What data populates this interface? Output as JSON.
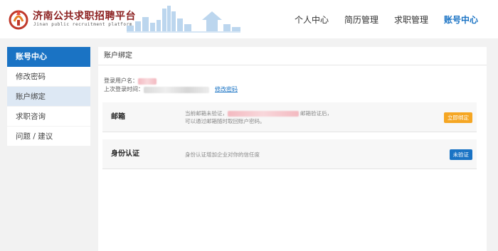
{
  "header": {
    "site_title": "济南公共求职招聘平台",
    "site_subtitle": "Jinan public recruitment platform",
    "logo_icon": "city-emblem-icon",
    "skyline_image": "city-skyline-illustration",
    "nav": [
      {
        "label": "个人中心",
        "active": false
      },
      {
        "label": "简历管理",
        "active": false
      },
      {
        "label": "求职管理",
        "active": false
      },
      {
        "label": "账号中心",
        "active": true
      }
    ]
  },
  "sidebar": {
    "title": "账号中心",
    "items": [
      {
        "label": "修改密码",
        "active": false
      },
      {
        "label": "账户绑定",
        "active": true
      },
      {
        "label": "求职咨询",
        "active": false
      },
      {
        "label": "问题 / 建议",
        "active": false
      }
    ]
  },
  "main": {
    "title": "账户绑定",
    "login_user_label": "登录用户名：",
    "last_login_label": "上次登录时间：",
    "change_password_link": "修改密码",
    "email": {
      "label": "邮箱",
      "desc_prefix": "当前邮箱未验证，",
      "desc_suffix": "邮箱验证后，",
      "desc_line2": "可以通过邮箱随时取回账户密码。",
      "button": "立即绑定"
    },
    "identity": {
      "label": "身份认证",
      "desc": "身份认证增加企业对你的信任度",
      "button": "未验证"
    }
  },
  "colors": {
    "accent": "#1a73c4",
    "bind_button": "#f5a623",
    "brand_title": "#8b1f1f"
  }
}
